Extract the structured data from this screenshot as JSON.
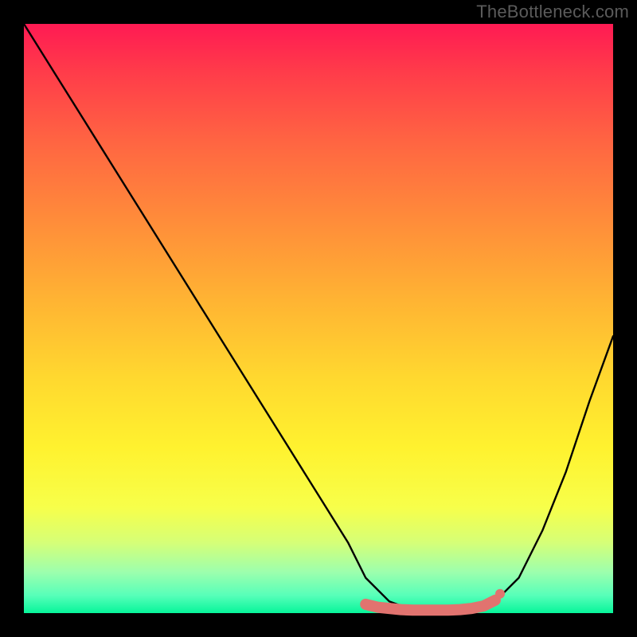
{
  "watermark": "TheBottleneck.com",
  "chart_data": {
    "type": "line",
    "title": "",
    "xlabel": "",
    "ylabel": "",
    "xlim": [
      0,
      100
    ],
    "ylim": [
      0,
      100
    ],
    "grid": false,
    "legend": false,
    "series": [
      {
        "name": "bottleneck-curve",
        "color": "#000000",
        "x": [
          0,
          5,
          10,
          15,
          20,
          25,
          30,
          35,
          40,
          45,
          50,
          55,
          58,
          62,
          66,
          70,
          74,
          78,
          80,
          84,
          88,
          92,
          96,
          100
        ],
        "y": [
          100,
          92,
          84,
          76,
          68,
          60,
          52,
          44,
          36,
          28,
          20,
          12,
          6,
          2,
          0.5,
          0,
          0,
          0.5,
          2,
          6,
          14,
          24,
          36,
          47
        ]
      }
    ],
    "markers": {
      "name": "highlight-band",
      "color": "#e1736f",
      "x": [
        58,
        60,
        62,
        64,
        66,
        68,
        70,
        72,
        74,
        76,
        78,
        80
      ],
      "y": [
        1.5,
        1,
        0.8,
        0.6,
        0.5,
        0.5,
        0.5,
        0.5,
        0.6,
        0.8,
        1.2,
        2.2
      ]
    },
    "gradient_stops": [
      {
        "pos": 0,
        "color": "#ff1a53"
      },
      {
        "pos": 8,
        "color": "#ff3b4a"
      },
      {
        "pos": 20,
        "color": "#ff6542"
      },
      {
        "pos": 33,
        "color": "#ff8b3a"
      },
      {
        "pos": 47,
        "color": "#ffb433"
      },
      {
        "pos": 60,
        "color": "#ffd82f"
      },
      {
        "pos": 72,
        "color": "#fff22f"
      },
      {
        "pos": 82,
        "color": "#f7ff4a"
      },
      {
        "pos": 88,
        "color": "#d6ff77"
      },
      {
        "pos": 93,
        "color": "#9dffad"
      },
      {
        "pos": 97,
        "color": "#57ffb9"
      },
      {
        "pos": 100,
        "color": "#07f59a"
      }
    ]
  }
}
